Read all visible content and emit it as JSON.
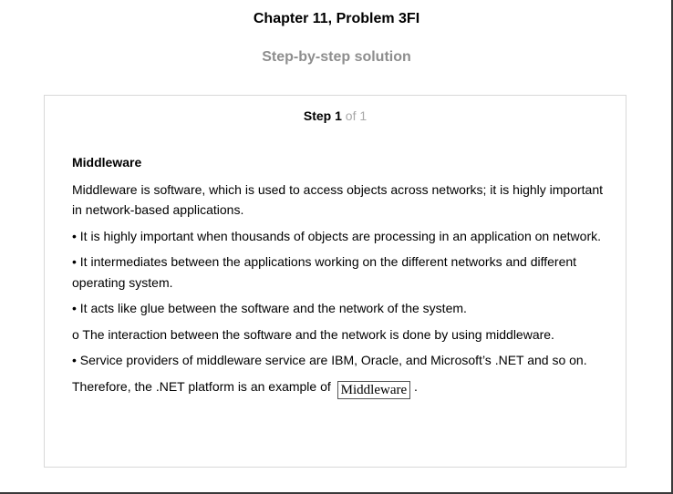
{
  "header": {
    "title": "Chapter 11, Problem 3FI",
    "subtitle": "Step-by-step solution"
  },
  "step": {
    "word": "Step",
    "number": "1",
    "of_total": "of 1"
  },
  "solution": {
    "heading": "Middleware",
    "definition": "Middleware is software, which is used to access objects across networks; it is highly important in network-based applications.",
    "bullets": [
      "• It is highly important when thousands of objects are processing in an application on network.",
      "• It intermediates between the applications working on the different networks and different operating system.",
      "• It acts like glue between the software and the network of the system.",
      "o The interaction between the software and the network is done by using middleware.",
      "• Service providers of middleware service are IBM, Oracle, and Microsoft’s .NET and so on."
    ],
    "conclusion_prefix": "Therefore, the .NET platform is an example of",
    "answer": "Middleware",
    "conclusion_suffix": "."
  }
}
